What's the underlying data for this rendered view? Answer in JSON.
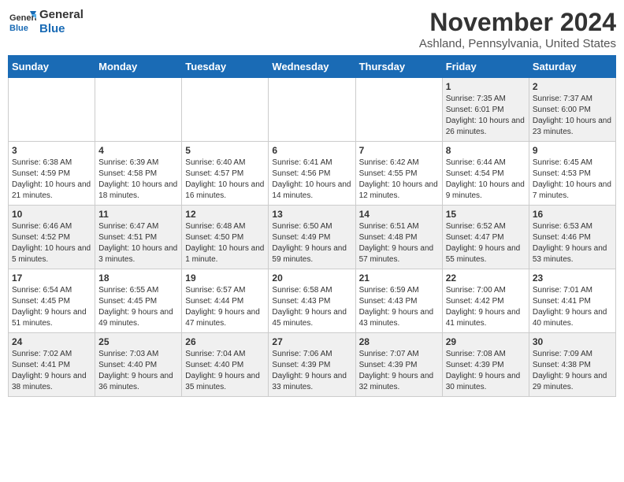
{
  "logo": {
    "line1": "General",
    "line2": "Blue"
  },
  "title": "November 2024",
  "subtitle": "Ashland, Pennsylvania, United States",
  "days_of_week": [
    "Sunday",
    "Monday",
    "Tuesday",
    "Wednesday",
    "Thursday",
    "Friday",
    "Saturday"
  ],
  "weeks": [
    [
      {
        "num": "",
        "info": ""
      },
      {
        "num": "",
        "info": ""
      },
      {
        "num": "",
        "info": ""
      },
      {
        "num": "",
        "info": ""
      },
      {
        "num": "",
        "info": ""
      },
      {
        "num": "1",
        "info": "Sunrise: 7:35 AM\nSunset: 6:01 PM\nDaylight: 10 hours and 26 minutes."
      },
      {
        "num": "2",
        "info": "Sunrise: 7:37 AM\nSunset: 6:00 PM\nDaylight: 10 hours and 23 minutes."
      }
    ],
    [
      {
        "num": "3",
        "info": "Sunrise: 6:38 AM\nSunset: 4:59 PM\nDaylight: 10 hours and 21 minutes."
      },
      {
        "num": "4",
        "info": "Sunrise: 6:39 AM\nSunset: 4:58 PM\nDaylight: 10 hours and 18 minutes."
      },
      {
        "num": "5",
        "info": "Sunrise: 6:40 AM\nSunset: 4:57 PM\nDaylight: 10 hours and 16 minutes."
      },
      {
        "num": "6",
        "info": "Sunrise: 6:41 AM\nSunset: 4:56 PM\nDaylight: 10 hours and 14 minutes."
      },
      {
        "num": "7",
        "info": "Sunrise: 6:42 AM\nSunset: 4:55 PM\nDaylight: 10 hours and 12 minutes."
      },
      {
        "num": "8",
        "info": "Sunrise: 6:44 AM\nSunset: 4:54 PM\nDaylight: 10 hours and 9 minutes."
      },
      {
        "num": "9",
        "info": "Sunrise: 6:45 AM\nSunset: 4:53 PM\nDaylight: 10 hours and 7 minutes."
      }
    ],
    [
      {
        "num": "10",
        "info": "Sunrise: 6:46 AM\nSunset: 4:52 PM\nDaylight: 10 hours and 5 minutes."
      },
      {
        "num": "11",
        "info": "Sunrise: 6:47 AM\nSunset: 4:51 PM\nDaylight: 10 hours and 3 minutes."
      },
      {
        "num": "12",
        "info": "Sunrise: 6:48 AM\nSunset: 4:50 PM\nDaylight: 10 hours and 1 minute."
      },
      {
        "num": "13",
        "info": "Sunrise: 6:50 AM\nSunset: 4:49 PM\nDaylight: 9 hours and 59 minutes."
      },
      {
        "num": "14",
        "info": "Sunrise: 6:51 AM\nSunset: 4:48 PM\nDaylight: 9 hours and 57 minutes."
      },
      {
        "num": "15",
        "info": "Sunrise: 6:52 AM\nSunset: 4:47 PM\nDaylight: 9 hours and 55 minutes."
      },
      {
        "num": "16",
        "info": "Sunrise: 6:53 AM\nSunset: 4:46 PM\nDaylight: 9 hours and 53 minutes."
      }
    ],
    [
      {
        "num": "17",
        "info": "Sunrise: 6:54 AM\nSunset: 4:45 PM\nDaylight: 9 hours and 51 minutes."
      },
      {
        "num": "18",
        "info": "Sunrise: 6:55 AM\nSunset: 4:45 PM\nDaylight: 9 hours and 49 minutes."
      },
      {
        "num": "19",
        "info": "Sunrise: 6:57 AM\nSunset: 4:44 PM\nDaylight: 9 hours and 47 minutes."
      },
      {
        "num": "20",
        "info": "Sunrise: 6:58 AM\nSunset: 4:43 PM\nDaylight: 9 hours and 45 minutes."
      },
      {
        "num": "21",
        "info": "Sunrise: 6:59 AM\nSunset: 4:43 PM\nDaylight: 9 hours and 43 minutes."
      },
      {
        "num": "22",
        "info": "Sunrise: 7:00 AM\nSunset: 4:42 PM\nDaylight: 9 hours and 41 minutes."
      },
      {
        "num": "23",
        "info": "Sunrise: 7:01 AM\nSunset: 4:41 PM\nDaylight: 9 hours and 40 minutes."
      }
    ],
    [
      {
        "num": "24",
        "info": "Sunrise: 7:02 AM\nSunset: 4:41 PM\nDaylight: 9 hours and 38 minutes."
      },
      {
        "num": "25",
        "info": "Sunrise: 7:03 AM\nSunset: 4:40 PM\nDaylight: 9 hours and 36 minutes."
      },
      {
        "num": "26",
        "info": "Sunrise: 7:04 AM\nSunset: 4:40 PM\nDaylight: 9 hours and 35 minutes."
      },
      {
        "num": "27",
        "info": "Sunrise: 7:06 AM\nSunset: 4:39 PM\nDaylight: 9 hours and 33 minutes."
      },
      {
        "num": "28",
        "info": "Sunrise: 7:07 AM\nSunset: 4:39 PM\nDaylight: 9 hours and 32 minutes."
      },
      {
        "num": "29",
        "info": "Sunrise: 7:08 AM\nSunset: 4:39 PM\nDaylight: 9 hours and 30 minutes."
      },
      {
        "num": "30",
        "info": "Sunrise: 7:09 AM\nSunset: 4:38 PM\nDaylight: 9 hours and 29 minutes."
      }
    ]
  ]
}
